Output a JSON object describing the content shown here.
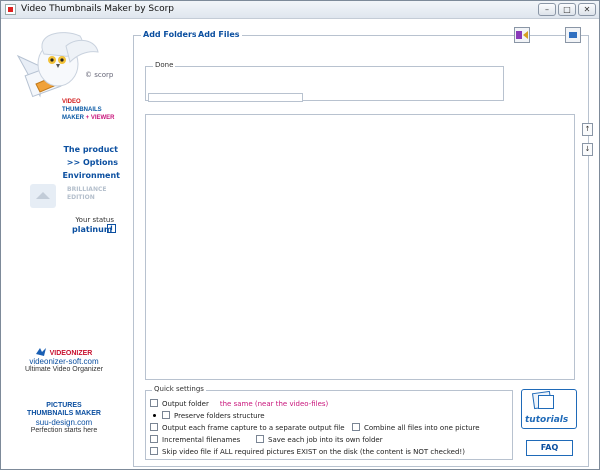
{
  "window": {
    "title": "Video Thumbnails Maker by Scorp"
  },
  "sidebar": {
    "scorp_line": "© scorp",
    "logo": {
      "line1": "VIDEO",
      "line2": "THUMBNAILS",
      "line3a": "MAKER",
      "line3b": " + VIEWER"
    },
    "links": [
      "The product",
      ">> Options",
      "Environment"
    ],
    "brilliance": {
      "line1": "BRILLIANCE",
      "line2": "EDITION"
    },
    "status_label": "Your status",
    "status_value": "platinum",
    "promo1": {
      "brand": "VIDEONIZER",
      "site": "videonizer-soft.com",
      "slogan": "Ultimate Video Organizer"
    },
    "promo2": {
      "brand_line1": "PICTURES",
      "brand_line2": "THUMBNAILS MAKER",
      "site": "suu-design.com",
      "slogan": "Perfection starts here"
    }
  },
  "main": {
    "add_folders": "Add Folders",
    "add_files": "Add Files",
    "done_label": "Done",
    "progress_value": 0
  },
  "quick_settings": {
    "legend": "Quick settings",
    "output_folder": "Output folder",
    "output_folder_value": "the same (near the video-files)",
    "preserve": "Preserve folders structure",
    "separate": "Output each frame capture to a separate output file",
    "combine": "Combine all files into one picture",
    "incremental": "Incremental filenames",
    "own_folder": "Save each job into its own folder",
    "skip": "Skip video file if ALL required pictures EXIST on the disk (the content is NOT checked!)"
  },
  "buttons": {
    "tutorials": "tutorials",
    "faq": "FAQ"
  },
  "colors": {
    "link_blue": "#0b4fa0",
    "accent_red": "#c8102e",
    "accent_magenta": "#c8157b"
  }
}
